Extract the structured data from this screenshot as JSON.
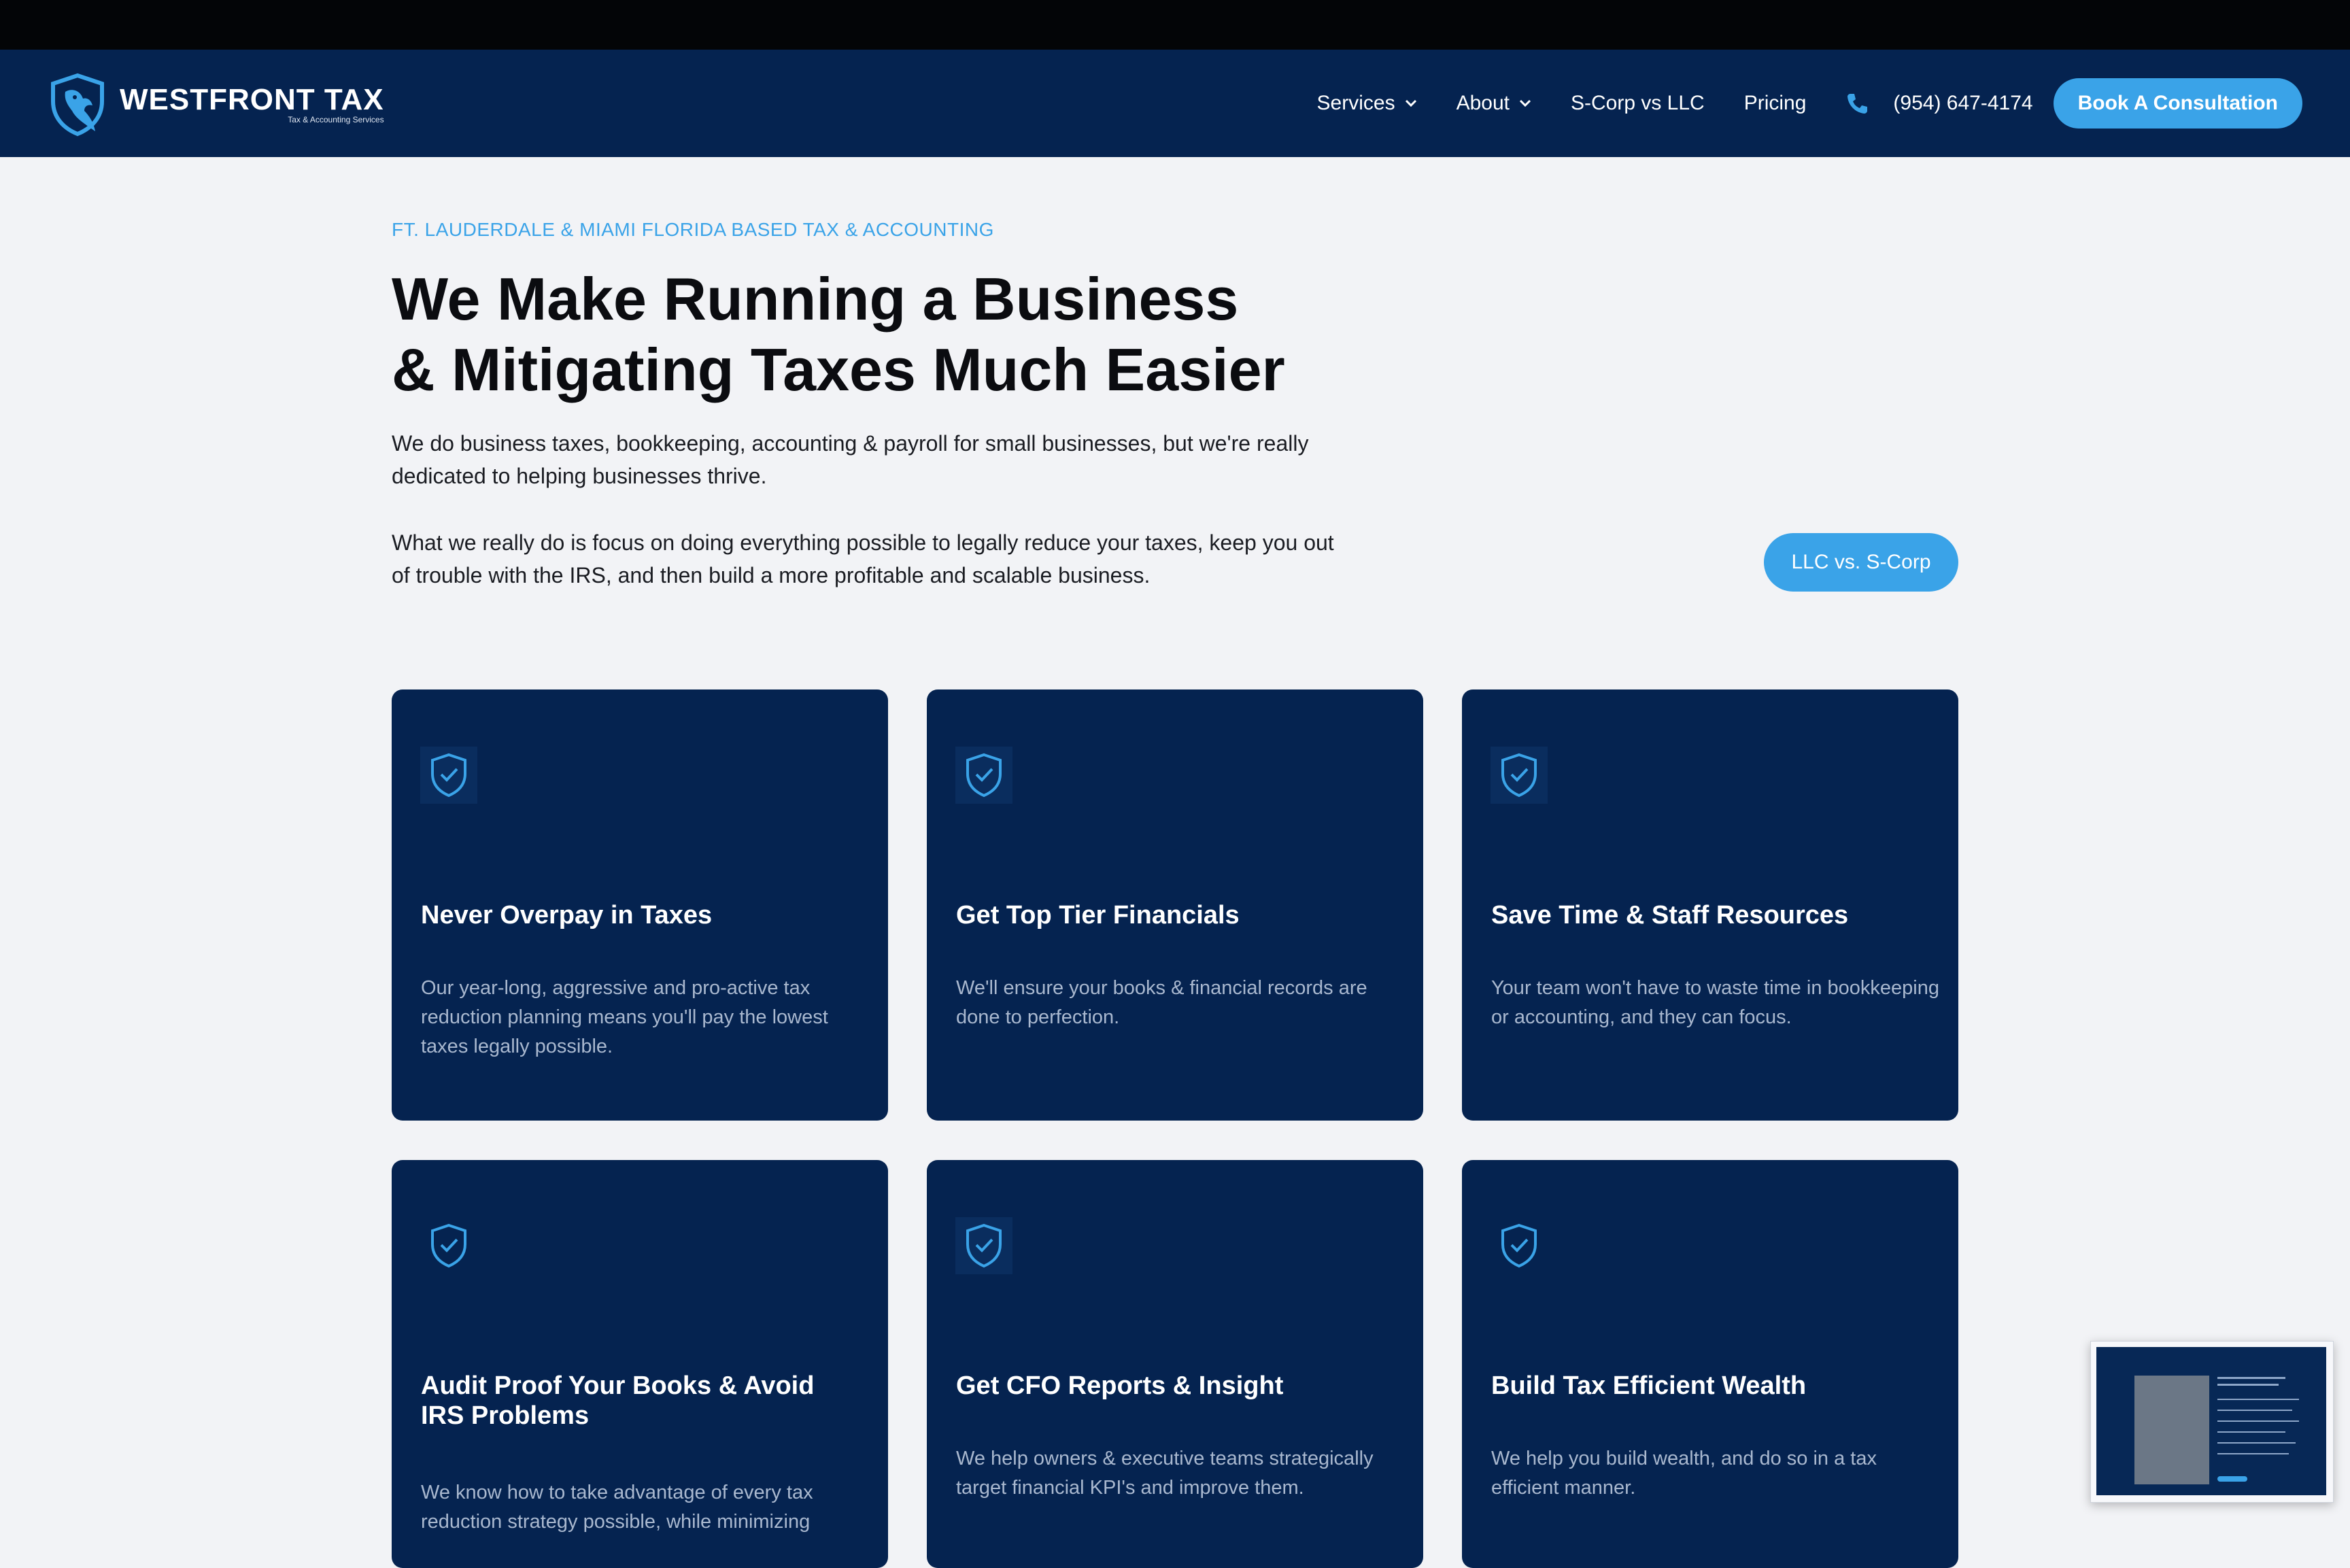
{
  "brand": {
    "name": "WESTFRONT TAX",
    "tagline": "Tax & Accounting Services",
    "accent": "#3aa3e8",
    "navy": "#052350"
  },
  "nav": {
    "items": [
      {
        "label": "Services",
        "dropdown": true
      },
      {
        "label": "About",
        "dropdown": true
      },
      {
        "label": "S-Corp vs LLC",
        "dropdown": false
      },
      {
        "label": "Pricing",
        "dropdown": false
      }
    ],
    "phone": "(954) 647-4174",
    "cta": "Book A Consultation"
  },
  "hero": {
    "eyebrow": "FT. LAUDERDALE & MIAMI FLORIDA BASED TAX & ACCOUNTING",
    "headline_line1": "We Make Running a Business",
    "headline_line2": "& Mitigating Taxes Much Easier",
    "paragraph1": "We do business taxes, bookkeeping, accounting & payroll for small businesses, but we're really dedicated to helping businesses thrive.",
    "paragraph2": "What we really do is focus on doing everything possible to legally reduce your taxes, keep you out of trouble with the IRS, and then build a more profitable and scalable business.",
    "button": "LLC vs. S-Corp"
  },
  "cards": [
    {
      "title": "Never Overpay in Taxes",
      "desc": "Our year-long, aggressive and pro-active tax reduction planning means you'll pay the lowest taxes legally possible."
    },
    {
      "title": "Get Top Tier Financials",
      "desc": "We'll ensure your books & financial records are done to perfection."
    },
    {
      "title": "Save Time & Staff Resources",
      "desc": "Your team won't have to waste time in bookkeeping or accounting, and they can focus."
    },
    {
      "title": "Audit Proof Your Books & Avoid IRS Problems",
      "desc": "We know how to take advantage of every tax reduction strategy possible, while minimizing"
    },
    {
      "title": "Get CFO Reports & Insight",
      "desc": "We help owners & executive teams strategically target financial KPI's and improve them."
    },
    {
      "title": "Build Tax Efficient Wealth",
      "desc": "We help you build wealth, and do so in a tax efficient manner."
    }
  ]
}
